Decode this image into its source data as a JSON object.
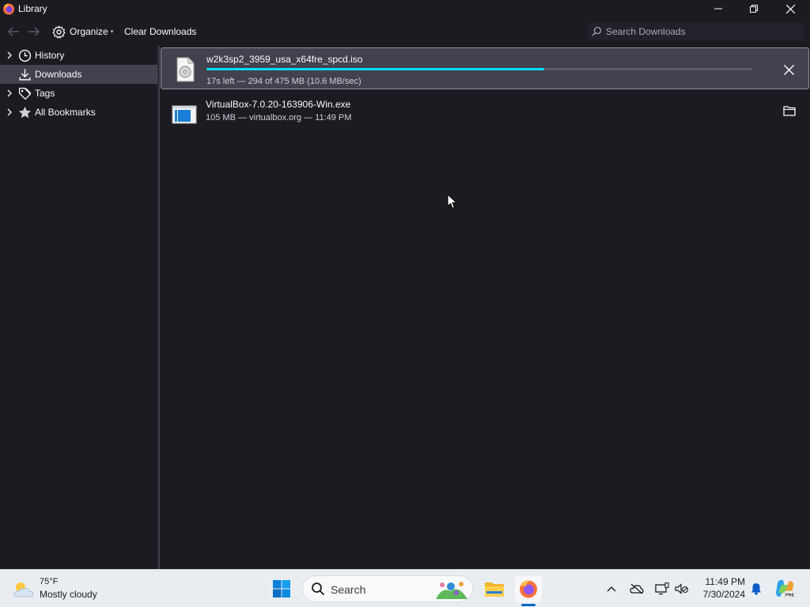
{
  "window": {
    "title": "Library",
    "controls": [
      "minimize",
      "maximize",
      "close"
    ]
  },
  "toolbar": {
    "organize_label": "Organize",
    "clear_label": "Clear Downloads",
    "search_placeholder": "Search Downloads"
  },
  "sidebar": {
    "items": [
      {
        "label": "History",
        "icon": "clock-icon",
        "expandable": true,
        "selected": false
      },
      {
        "label": "Downloads",
        "icon": "download-icon",
        "expandable": false,
        "selected": true
      },
      {
        "label": "Tags",
        "icon": "tag-icon",
        "expandable": true,
        "selected": false
      },
      {
        "label": "All Bookmarks",
        "icon": "star-icon",
        "expandable": true,
        "selected": false
      }
    ]
  },
  "downloads": [
    {
      "name": "w2k3sp2_3959_usa_x64fre_spcd.iso",
      "status": "17s left — 294 of 475 MB (10.6 MB/sec)",
      "progress_percent": 61.9,
      "in_progress": true,
      "action": "cancel",
      "icon": "disc-file-icon"
    },
    {
      "name": "VirtualBox-7.0.20-163906-Win.exe",
      "status": "105 MB — virtualbox.org — 11:49 PM",
      "in_progress": false,
      "action": "show-in-folder",
      "icon": "exe-file-icon"
    }
  ],
  "taskbar": {
    "weather_temp": "75°F",
    "weather_condition": "Mostly cloudy",
    "search_label": "Search",
    "time": "11:49 PM",
    "date": "7/30/2024"
  },
  "colors": {
    "accent": "#00ddff",
    "background": "#1c1b22",
    "selected_row": "#42414d"
  }
}
